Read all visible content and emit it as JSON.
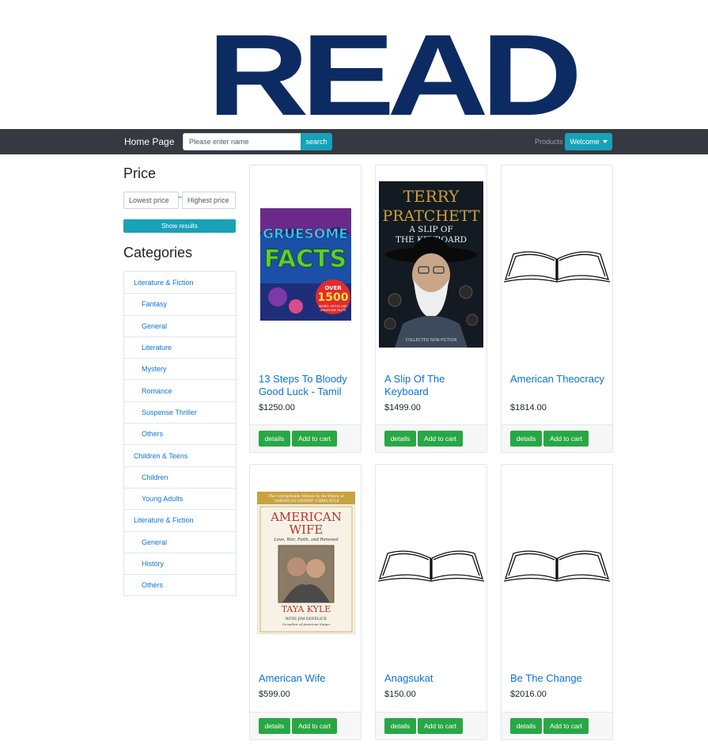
{
  "logo": {
    "text": "READ"
  },
  "navbar": {
    "brand": "Home Page",
    "search_placeholder": "Please enter name",
    "search_button": "search",
    "products_link": "Products",
    "welcome_button": "Welcome"
  },
  "sidebar": {
    "price_heading": "Price",
    "lowest_placeholder": "Lowest price",
    "tilde": "~",
    "highest_placeholder": "Highest price",
    "show_results": "Show results",
    "categories_heading": "Categories",
    "categories": [
      {
        "label": "Literature & Fiction",
        "level": 0
      },
      {
        "label": "Fantasy",
        "level": 1
      },
      {
        "label": "General",
        "level": 1
      },
      {
        "label": "Literature",
        "level": 1
      },
      {
        "label": "Mystery",
        "level": 1
      },
      {
        "label": "Romance",
        "level": 1
      },
      {
        "label": "Suspense Thriller",
        "level": 1
      },
      {
        "label": "Others",
        "level": 1
      },
      {
        "label": "Children & Teens",
        "level": 0
      },
      {
        "label": "Children",
        "level": 1
      },
      {
        "label": "Young Adults",
        "level": 1
      },
      {
        "label": "Literature & Fiction",
        "level": 0
      },
      {
        "label": "General",
        "level": 1
      },
      {
        "label": "History",
        "level": 1
      },
      {
        "label": "Others",
        "level": 1
      }
    ]
  },
  "products": [
    {
      "title": "13 Steps To Bloody Good Luck - Tamil",
      "price": "$1250.00",
      "details": "details",
      "add_to_cart": "Add to cart",
      "cover": {
        "type": "gruesome",
        "lines": [
          "GRUESOME",
          "FACTS"
        ],
        "badge": [
          "OVER",
          "1500",
          "WEIRD, GROSS AND",
          "GRUESOME FACTS"
        ]
      }
    },
    {
      "title": "A Slip Of The Keyboard",
      "price": "$1499.00",
      "details": "details",
      "add_to_cart": "Add to cart",
      "cover": {
        "type": "pratchett",
        "lines": [
          "TERRY",
          "PRATCHETT",
          "A SLIP OF",
          "THE KEYBOARD"
        ],
        "footer": "COLLECTED NON-FICTION"
      }
    },
    {
      "title": "American Theocracy",
      "price": "$1814.00",
      "details": "details",
      "add_to_cart": "Add to cart",
      "cover": {
        "type": "placeholder"
      }
    },
    {
      "title": "American Wife",
      "price": "$599.00",
      "details": "details",
      "add_to_cart": "Add to cart",
      "cover": {
        "type": "americanwife",
        "banner": [
          "The Unforgettable Memoir by the Widow of",
          "\"AMERICAN SNIPER\" CHRIS KYLE"
        ],
        "title": [
          "AMERICAN",
          "WIFE"
        ],
        "subtitle": "Love, War, Faith, and Renewal",
        "author": "TAYA KYLE",
        "with": "WITH JIM DEFELICE",
        "coauthor": "Co-author of American Sniper"
      }
    },
    {
      "title": "Anagsukat",
      "price": "$150.00",
      "details": "details",
      "add_to_cart": "Add to cart",
      "cover": {
        "type": "placeholder"
      }
    },
    {
      "title": "Be The Change",
      "price": "$2016.00",
      "details": "details",
      "add_to_cart": "Add to cart",
      "cover": {
        "type": "placeholder"
      }
    }
  ],
  "colors": {
    "navbar_bg": "#343a40",
    "accent": "#17a2b8",
    "success": "#28a745",
    "link": "#0b74d6",
    "logo": "#0d2b63"
  }
}
